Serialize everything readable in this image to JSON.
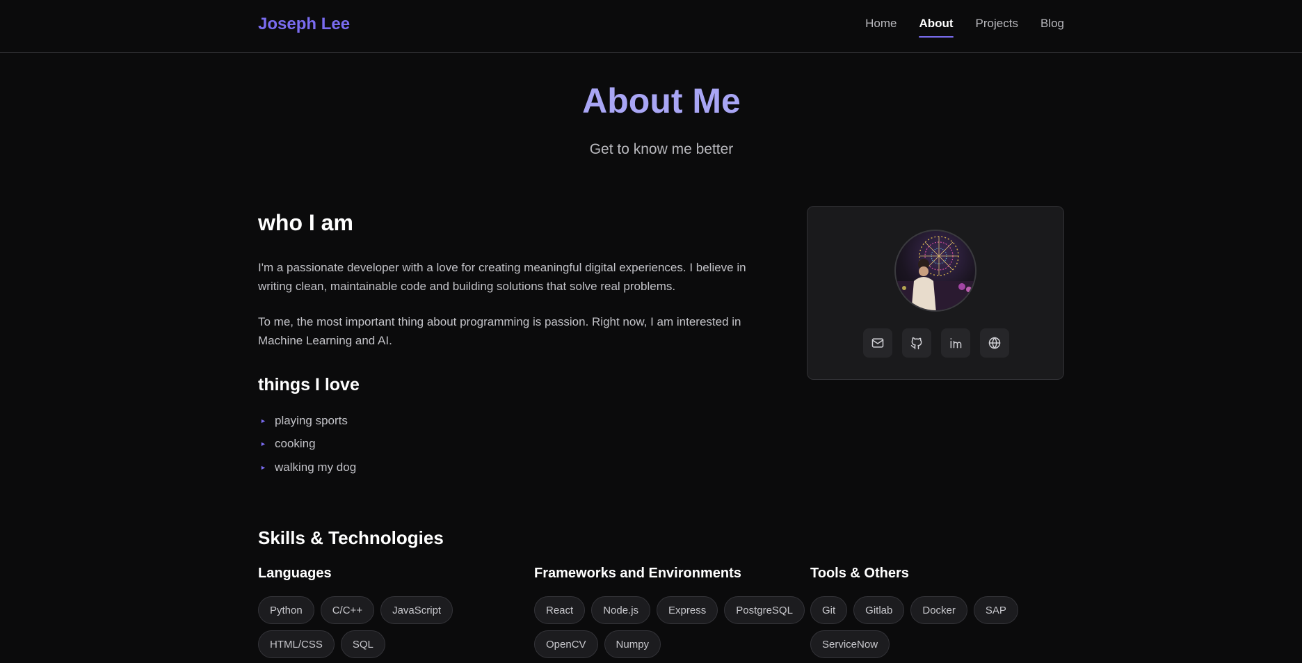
{
  "nav": {
    "brand": "Joseph Lee",
    "links": [
      {
        "label": "Home"
      },
      {
        "label": "About"
      },
      {
        "label": "Projects"
      },
      {
        "label": "Blog"
      }
    ]
  },
  "hero": {
    "title": "About Me",
    "subtitle": "Get to know me better"
  },
  "about": {
    "who_title": "who I am",
    "paragraphs": [
      "I'm a passionate developer with a love for creating meaningful digital experiences. I believe in writing clean, maintainable code and building solutions that solve real problems.",
      "To me, the most important thing about programming is passion. Right now, I am interested in Machine Learning and AI."
    ],
    "love_title": "things I love",
    "loves": [
      "playing sports",
      "cooking",
      "walking my dog"
    ]
  },
  "profile": {
    "social_icons": [
      "mail-icon",
      "github-icon",
      "linkedin-icon",
      "globe-icon"
    ]
  },
  "skills": {
    "title": "Skills & Technologies",
    "groups": [
      {
        "title": "Languages",
        "items": [
          "Python",
          "C/C++",
          "JavaScript",
          "HTML/CSS",
          "SQL"
        ]
      },
      {
        "title": "Frameworks and Environments",
        "items": [
          "React",
          "Node.js",
          "Express",
          "PostgreSQL",
          "OpenCV",
          "Numpy"
        ]
      },
      {
        "title": "Tools & Others",
        "items": [
          "Git",
          "Gitlab",
          "Docker",
          "SAP",
          "ServiceNow"
        ]
      }
    ]
  },
  "colors": {
    "accent": "#7a6cf0",
    "hero_title": "#a9a6f5",
    "background": "#0b0b0c"
  }
}
